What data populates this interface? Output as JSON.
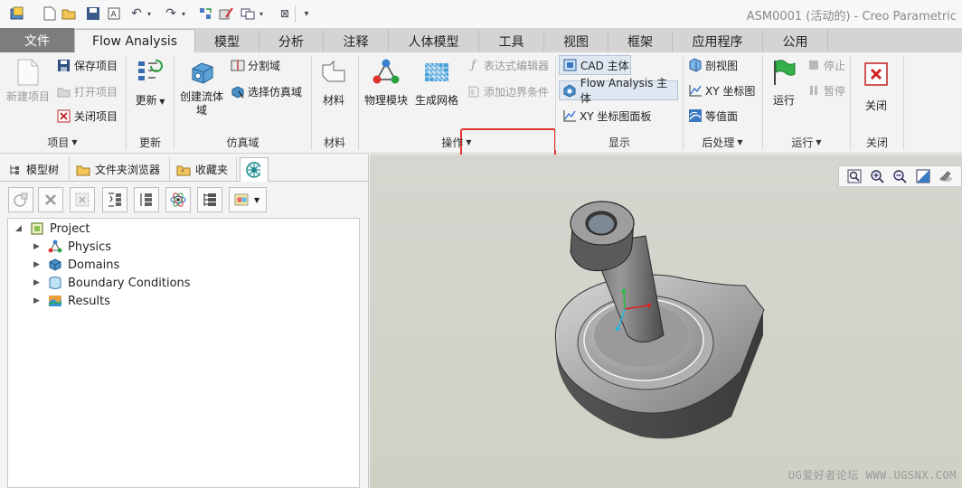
{
  "app": {
    "title": "ASM0001 (活动的) - Creo Parametric"
  },
  "quick_access": [
    "app-icon",
    "new-icon",
    "open-icon",
    "save-icon",
    "text-icon",
    "undo-icon",
    "redo-icon",
    "regenerate-icon",
    "window-icon",
    "close-window-icon",
    "customize-icon"
  ],
  "tabs": [
    {
      "label": "文件"
    },
    {
      "label": "Flow Analysis"
    },
    {
      "label": "模型"
    },
    {
      "label": "分析"
    },
    {
      "label": "注释"
    },
    {
      "label": "人体模型"
    },
    {
      "label": "工具"
    },
    {
      "label": "视图"
    },
    {
      "label": "框架"
    },
    {
      "label": "应用程序"
    },
    {
      "label": "公用"
    }
  ],
  "ribbon": {
    "project": {
      "label": "项目",
      "new_project": "新建项目",
      "save_project": "保存项目",
      "open_project": "打开项目",
      "close_project": "关闭项目"
    },
    "update": {
      "label": "更新",
      "update_button": "更新"
    },
    "domain": {
      "label": "仿真域",
      "create_fluid_domain": "创建流体域",
      "split_domain": "分割域",
      "select_sim_domain": "选择仿真域"
    },
    "material": {
      "label": "材料",
      "material_button": "材料"
    },
    "operation": {
      "label": "操作",
      "physics_module": "物理模块",
      "generate_mesh": "生成网格",
      "expression_editor": "表达式编辑器",
      "add_boundary_condition": "添加边界条件"
    },
    "display": {
      "label": "显示",
      "cad_body": "CAD 主体",
      "flow_analysis_body": "Flow Analysis 主体",
      "xy_plot_panel": "XY 坐标图面板"
    },
    "post": {
      "label": "后处理",
      "section_view": "剖视图",
      "xy_plot": "XY 坐标图",
      "contour": "等值面"
    },
    "run": {
      "label": "运行",
      "run_button": "运行",
      "stop": "停止",
      "pause": "暂停"
    },
    "close": {
      "label": "关闭",
      "close_button": "关闭"
    }
  },
  "panel": {
    "tabs": [
      "模型树",
      "文件夹浏览器",
      "收藏夹"
    ],
    "tree": {
      "root": "Project",
      "children": [
        "Physics",
        "Domains",
        "Boundary Conditions",
        "Results"
      ]
    }
  },
  "viewport": {
    "watermark": "UG爱好者论坛 WWW.UGSNX.COM",
    "toolbar": [
      "refit-icon",
      "zoom-in-icon",
      "zoom-out-icon",
      "view-orientation-icon",
      "display-style-icon"
    ]
  },
  "colors": {
    "highlight": "#e53333",
    "file_tab": "#7d7d7d",
    "axis_x": "#e02020",
    "axis_y": "#20c040",
    "axis_z": "#20b8e0"
  }
}
